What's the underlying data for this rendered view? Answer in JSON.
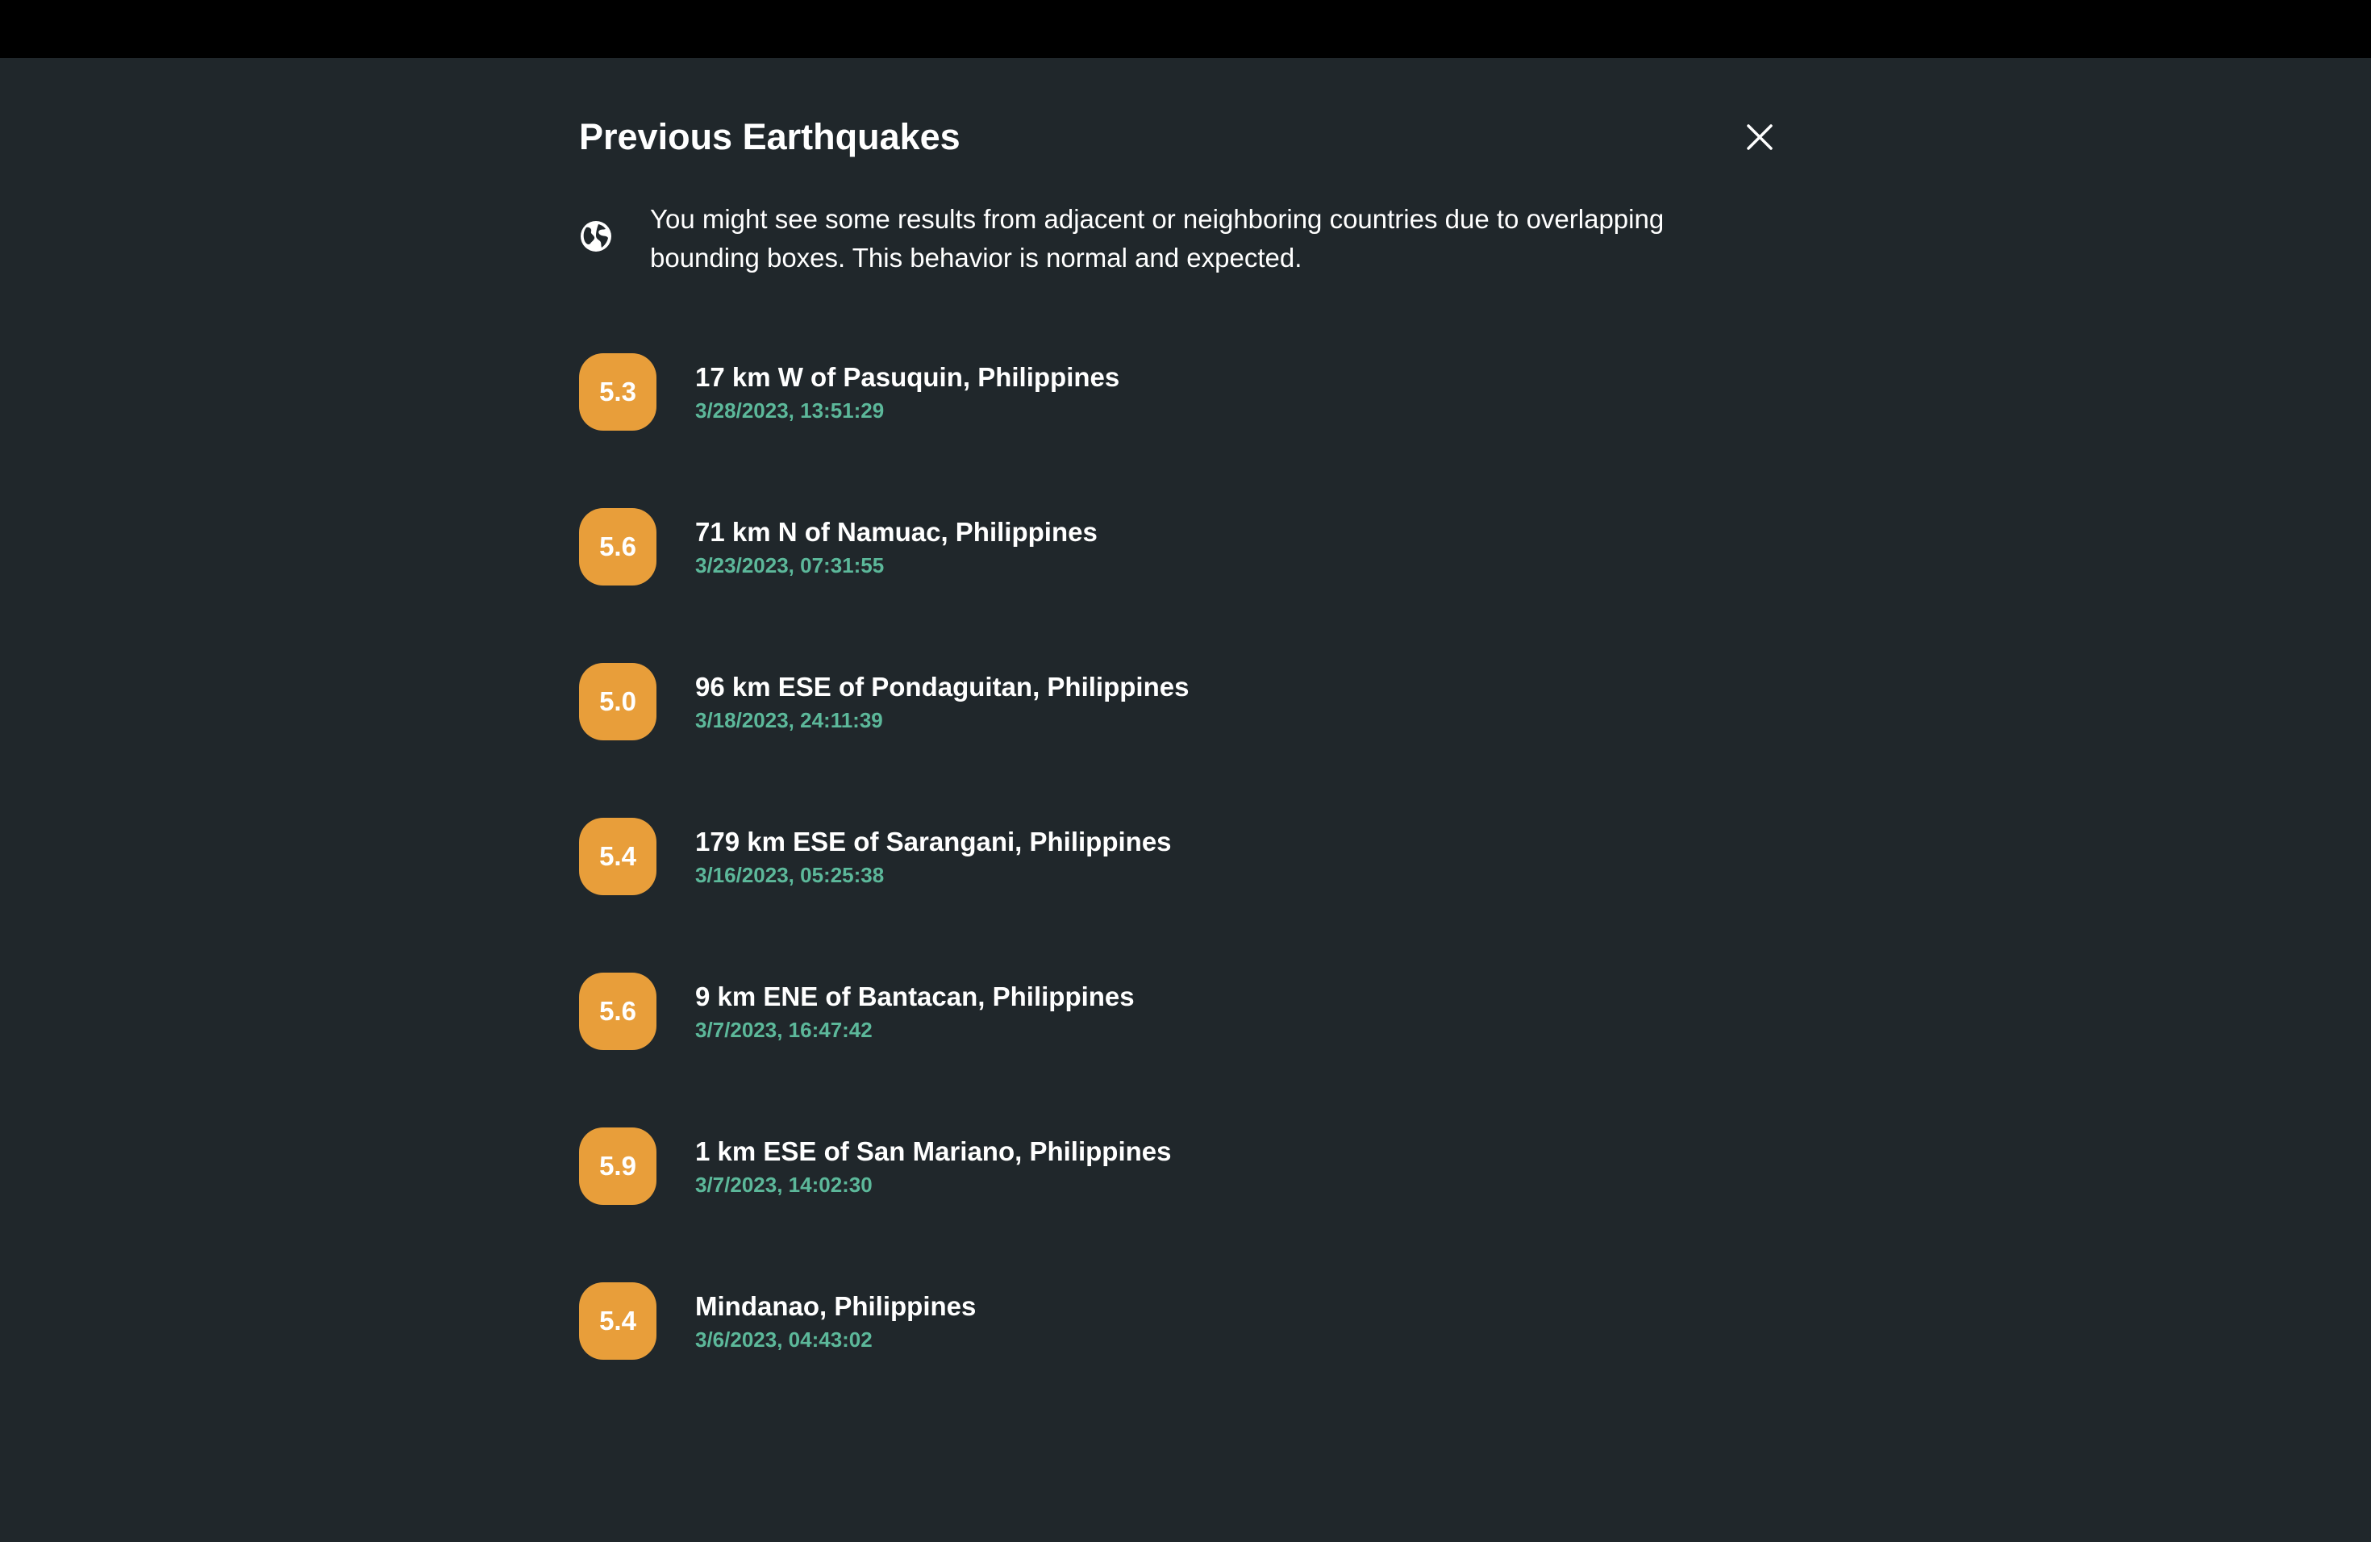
{
  "dialog": {
    "title": "Previous Earthquakes",
    "close_icon": "close-icon",
    "notice": {
      "icon": "globe-icon",
      "text": "You might see some results from adjacent or neighboring countries due to overlapping bounding boxes. This behavior is normal and expected."
    }
  },
  "colors": {
    "background": "#20272b",
    "top_bar": "#000000",
    "badge": "#e89e3a",
    "timestamp": "#5cb89a",
    "text": "#ffffff"
  },
  "earthquakes": [
    {
      "magnitude": "5.3",
      "place": "17 km W of Pasuquin, Philippines",
      "time": "3/28/2023, 13:51:29"
    },
    {
      "magnitude": "5.6",
      "place": "71 km N of Namuac, Philippines",
      "time": "3/23/2023, 07:31:55"
    },
    {
      "magnitude": "5.0",
      "place": "96 km ESE of Pondaguitan, Philippines",
      "time": "3/18/2023, 24:11:39"
    },
    {
      "magnitude": "5.4",
      "place": "179 km ESE of Sarangani, Philippines",
      "time": "3/16/2023, 05:25:38"
    },
    {
      "magnitude": "5.6",
      "place": "9 km ENE of Bantacan, Philippines",
      "time": "3/7/2023, 16:47:42"
    },
    {
      "magnitude": "5.9",
      "place": "1 km ESE of San Mariano, Philippines",
      "time": "3/7/2023, 14:02:30"
    },
    {
      "magnitude": "5.4",
      "place": "Mindanao, Philippines",
      "time": "3/6/2023, 04:43:02"
    }
  ]
}
